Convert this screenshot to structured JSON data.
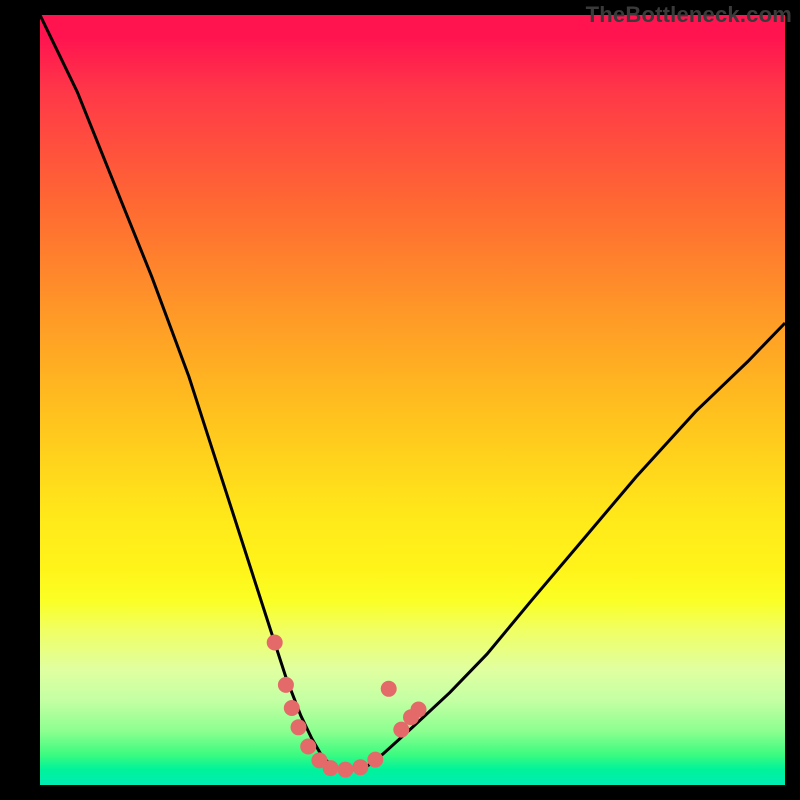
{
  "watermark": "TheBottleneck.com",
  "chart_data": {
    "type": "line",
    "title": "",
    "xlabel": "",
    "ylabel": "",
    "xlim": [
      0,
      100
    ],
    "ylim": [
      0,
      100
    ],
    "series": [
      {
        "name": "curve",
        "x": [
          0,
          5,
          10,
          15,
          20,
          23,
          26,
          29,
          31,
          33,
          35,
          36.5,
          38,
          40,
          42,
          44,
          46,
          50,
          55,
          60,
          66,
          73,
          80,
          88,
          95,
          100
        ],
        "values": [
          100,
          90,
          78,
          66,
          53,
          44,
          35,
          26,
          20,
          14,
          9,
          6,
          3.5,
          2,
          2,
          2.5,
          4,
          7.5,
          12,
          17,
          24,
          32,
          40,
          48.5,
          55,
          60
        ]
      }
    ],
    "markers": {
      "name": "dots",
      "color": "#e46a6a",
      "radius_px": 8,
      "points": [
        {
          "x": 31.5,
          "y": 18.5
        },
        {
          "x": 33.0,
          "y": 13.0
        },
        {
          "x": 33.8,
          "y": 10.0
        },
        {
          "x": 34.7,
          "y": 7.5
        },
        {
          "x": 36.0,
          "y": 5.0
        },
        {
          "x": 37.5,
          "y": 3.2
        },
        {
          "x": 39.0,
          "y": 2.2
        },
        {
          "x": 41.0,
          "y": 2.0
        },
        {
          "x": 43.0,
          "y": 2.3
        },
        {
          "x": 45.0,
          "y": 3.3
        },
        {
          "x": 46.8,
          "y": 12.5
        },
        {
          "x": 48.5,
          "y": 7.2
        },
        {
          "x": 49.8,
          "y": 8.8
        },
        {
          "x": 50.8,
          "y": 9.8
        }
      ]
    },
    "colors": {
      "curve_stroke": "#000000",
      "marker_fill": "#e46a6a",
      "background_top": "#ff1450",
      "background_bottom": "#00ecb4",
      "frame": "#000000"
    }
  }
}
